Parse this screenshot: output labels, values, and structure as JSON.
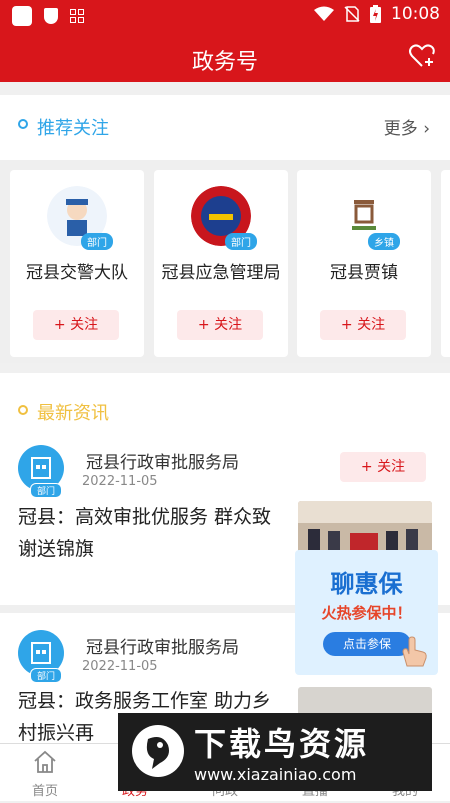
{
  "statusbar": {
    "time": "10:08"
  },
  "header": {
    "title": "政务号"
  },
  "recommend": {
    "title": "推荐关注",
    "more": "更多",
    "cards": [
      {
        "name": "冠县交警大队",
        "tag": "部门",
        "follow": "+ 关注"
      },
      {
        "name": "冠县应急管理局",
        "tag": "部门",
        "follow": "+ 关注"
      },
      {
        "name": "冠县贾镇",
        "tag": "乡镇",
        "follow": "+ 关注"
      }
    ]
  },
  "news": {
    "title": "最新资讯",
    "items": [
      {
        "source": "冠县行政审批服务局",
        "tag": "部门",
        "date": "2022-11-05",
        "follow": "+ 关注",
        "headline": "冠县：高效审批优服务 群众致谢送锦旗"
      },
      {
        "source": "冠县行政审批服务局",
        "tag": "部门",
        "date": "2022-11-05",
        "headline": "冠县：政务服务工作室 助力乡村振兴再"
      }
    ]
  },
  "ad": {
    "title": "聊惠保",
    "subtitle": "火热参保中！",
    "button": "点击参保"
  },
  "tabs": [
    {
      "label": "首页",
      "active": false
    },
    {
      "label": "政务",
      "active": true
    },
    {
      "label": "问政",
      "active": false
    },
    {
      "label": "直播",
      "active": false
    },
    {
      "label": "我的",
      "active": false
    }
  ],
  "watermark": {
    "title": "下载鸟资源",
    "url": "www.xiazainiao.com"
  },
  "colors": {
    "brand_red": "#d8161b",
    "accent_blue": "#2fa5e8",
    "accent_yellow": "#f0c040"
  }
}
